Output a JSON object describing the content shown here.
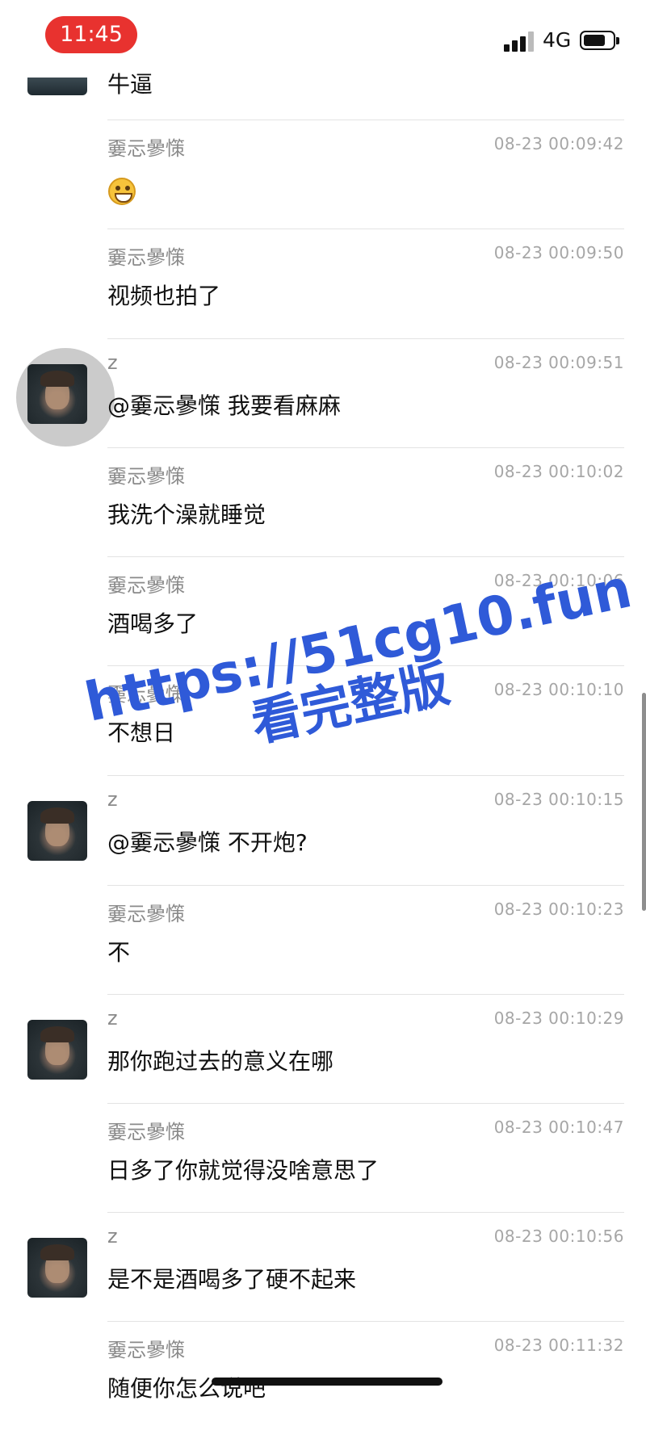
{
  "status_bar": {
    "time": "11:45",
    "network": "4G"
  },
  "chat": {
    "top_partial_text": "牛逼",
    "messages": [
      {
        "sender": "嫑忈曑憡",
        "time": "08-23 00:09:42",
        "text": "",
        "emoji": "grinning-face",
        "avatar": false
      },
      {
        "sender": "嫑忈曑憡",
        "time": "08-23 00:09:50",
        "text": "视频也拍了",
        "avatar": false
      },
      {
        "sender": "z",
        "time": "08-23 00:09:51",
        "text": "@嫑忈曑憡 我要看麻麻",
        "avatar": true
      },
      {
        "sender": "嫑忈曑憡",
        "time": "08-23 00:10:02",
        "text": "我洗个澡就睡觉",
        "avatar": false
      },
      {
        "sender": "嫑忈曑憡",
        "time": "08-23 00:10:06",
        "text": "酒喝多了",
        "avatar": false
      },
      {
        "sender": "嫑忈曑憡",
        "time": "08-23 00:10:10",
        "text": "不想日",
        "avatar": false
      },
      {
        "sender": "z",
        "time": "08-23 00:10:15",
        "text": "@嫑忈曑憡 不开炮?",
        "avatar": true
      },
      {
        "sender": "嫑忈曑憡",
        "time": "08-23 00:10:23",
        "text": "不",
        "avatar": false
      },
      {
        "sender": "z",
        "time": "08-23 00:10:29",
        "text": "那你跑过去的意义在哪",
        "avatar": true
      },
      {
        "sender": "嫑忈曑憡",
        "time": "08-23 00:10:47",
        "text": "日多了你就觉得没啥意思了",
        "avatar": false
      },
      {
        "sender": "z",
        "time": "08-23 00:10:56",
        "text": "是不是酒喝多了硬不起来",
        "avatar": true
      },
      {
        "sender": "嫑忈曑憡",
        "time": "08-23 00:11:32",
        "text": "随便你怎么说吧",
        "avatar": false
      }
    ]
  },
  "watermark": {
    "line1": "https://51cg10.fun",
    "line2": "看完整版"
  },
  "colors": {
    "time_pill": "#e8322f",
    "watermark": "#2f5ad8"
  }
}
